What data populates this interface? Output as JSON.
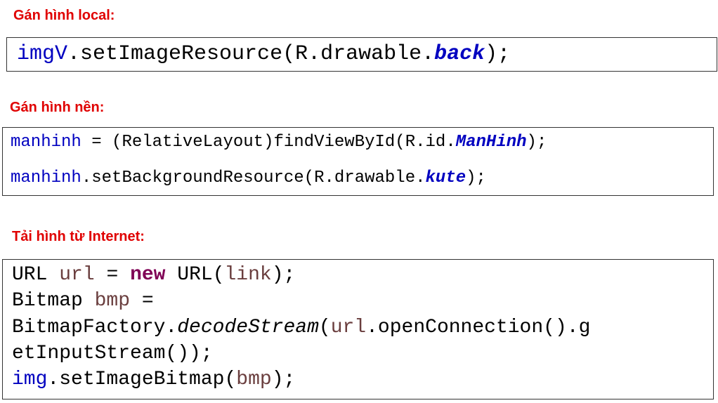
{
  "sections": [
    {
      "heading": "Gán hình local:",
      "code": {
        "line1": {
          "var": "imgV",
          "call": ".setImageResource(R.drawable.",
          "const": "back",
          "end": ");"
        }
      }
    },
    {
      "heading": "Gán hình nền:",
      "code": {
        "line1": {
          "var": "manhinh",
          "mid": " = (RelativeLayout)findViewById(R.id.",
          "const": "ManHinh",
          "end": ");"
        },
        "line2": {
          "var": "manhinh",
          "call": ".setBackgroundResource(R.drawable.",
          "const": "kute",
          "end": ");"
        }
      }
    },
    {
      "heading": "Tải hình từ Internet:",
      "code": {
        "line1": {
          "type": "URL ",
          "var": "url",
          "eq": " = ",
          "keyword": "new",
          "ctor": " URL(",
          "arg": "link",
          "end": ");"
        },
        "line2": {
          "type": "Bitmap ",
          "var": "bmp",
          "eq": " ="
        },
        "line3": {
          "cls": "BitmapFactory.",
          "method": "decodeStream",
          "open": "(",
          "var": "url",
          "rest": ".openConnection().g"
        },
        "line4": {
          "text": "etInputStream());"
        },
        "line5": {
          "var": "img",
          "call": ".setImageBitmap(",
          "arg": "bmp",
          "end": ");"
        }
      }
    }
  ],
  "colors": {
    "heading": "#e00000",
    "field_var": "#0000c0",
    "local_var": "#6a3e3e",
    "keyword": "#7f0055",
    "constant": "#0000c0",
    "border": "#333333"
  }
}
